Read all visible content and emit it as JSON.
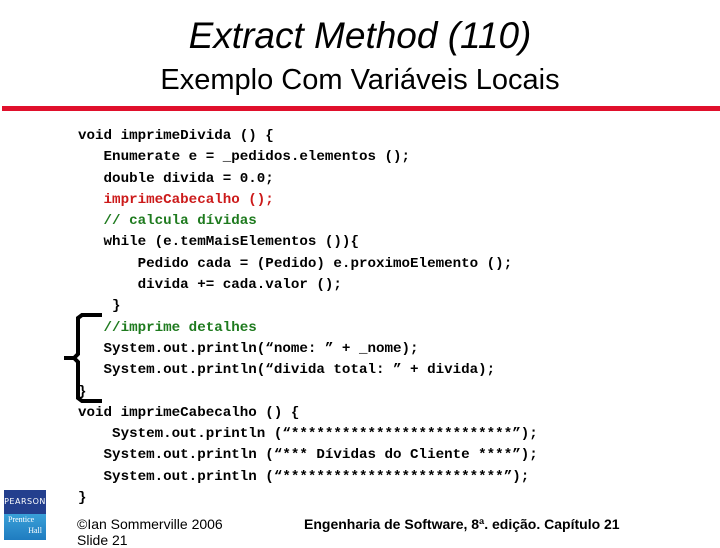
{
  "slide": {
    "title": "Extract Method (110)",
    "subtitle": "Exemplo Com Variáveis Locais",
    "accent_color": "#e0102c",
    "code_lines": [
      {
        "text": "void imprimeDivida () {",
        "style": "normal"
      },
      {
        "text": "   Enumerate e = _pedidos.elementos ();",
        "style": "normal"
      },
      {
        "text": "   double divida = 0.0;",
        "style": "normal"
      },
      {
        "text": "   imprimeCabecalho ();",
        "style": "red"
      },
      {
        "text": "   // calcula dívidas",
        "style": "green"
      },
      {
        "text": "   while (e.temMaisElementos ()){",
        "style": "normal"
      },
      {
        "text": "       Pedido cada = (Pedido) e.proximoElemento ();",
        "style": "normal"
      },
      {
        "text": "       divida += cada.valor ();",
        "style": "normal"
      },
      {
        "text": "    }",
        "style": "normal"
      },
      {
        "text": "   //imprime detalhes",
        "style": "green"
      },
      {
        "text": "   System.out.println(“nome: ” + _nome);",
        "style": "normal"
      },
      {
        "text": "   System.out.println(“divida total: ” + divida);",
        "style": "normal"
      },
      {
        "text": "}",
        "style": "normal"
      },
      {
        "text": "void imprimeCabecalho () {",
        "style": "normal"
      },
      {
        "text": "    System.out.println (“**************************”);",
        "style": "normal"
      },
      {
        "text": "   System.out.println (“*** Dívidas do Cliente ****”);",
        "style": "normal"
      },
      {
        "text": "   System.out.println (“**************************”);",
        "style": "normal"
      },
      {
        "text": "}",
        "style": "normal"
      }
    ]
  },
  "footer": {
    "logo_top": "PEARSON",
    "logo_bottom_1": "Prentice",
    "logo_bottom_2": "Hall",
    "copyright": "©Ian Sommerville 2006",
    "slide_label": "Slide 21",
    "book": "Engenharia de Software, 8ª. edição. Capítulo 21"
  }
}
